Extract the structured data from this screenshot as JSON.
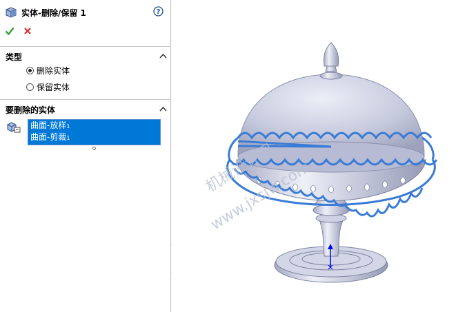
{
  "panel": {
    "title": "实体-删除/保留 1",
    "help_icon": "question-icon",
    "ok_icon": "checkmark-icon",
    "cancel_icon": "x-icon"
  },
  "type_section": {
    "title": "类型",
    "options": [
      {
        "label": "删除实体",
        "checked": true
      },
      {
        "label": "保留实体",
        "checked": false
      }
    ]
  },
  "bodies_section": {
    "title": "要删除的实体",
    "items": [
      {
        "label": "曲面-放样",
        "sub": "1"
      },
      {
        "label": "曲面-剪裁",
        "sub": "1"
      }
    ]
  },
  "viewport": {
    "watermark_line1": "机械设计网",
    "watermark_line2": "www.jxsjw.com"
  },
  "colors": {
    "selection_blue": "#0078d7",
    "highlight_blue": "#3a7bd5",
    "model_gray": "#c9cde0",
    "ok_green": "#2e9e2e",
    "cancel_red": "#d42a2a"
  }
}
